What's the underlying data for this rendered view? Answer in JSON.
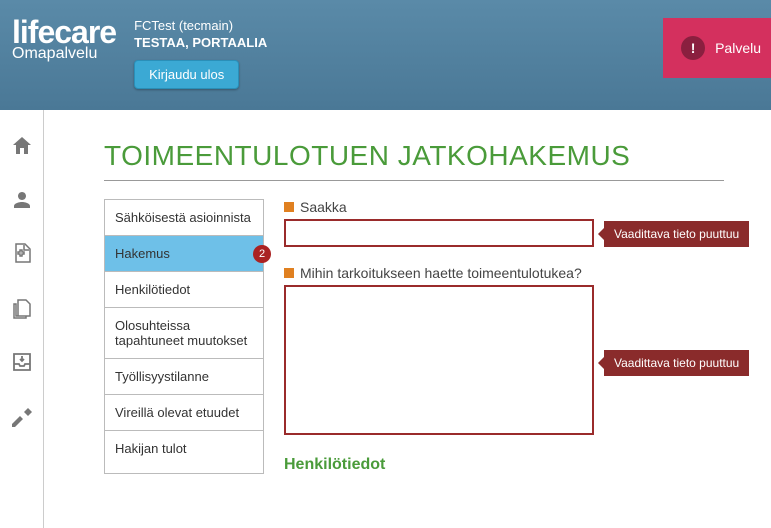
{
  "header": {
    "logo_main": "lifecare",
    "logo_sub": "Omapalvelu",
    "user_context": "FCTest (tecmain)",
    "user_name": "TESTAA, PORTAALIA",
    "logout_label": "Kirjaudu ulos",
    "alert_label": "Palvelu",
    "alert_glyph": "!"
  },
  "page": {
    "title": "TOIMEENTULOTUEN JATKOHAKEMUS"
  },
  "steps": [
    {
      "label": "Sähköisestä asioinnista",
      "active": false
    },
    {
      "label": "Hakemus",
      "active": true,
      "badge": "2"
    },
    {
      "label": "Henkilötiedot",
      "active": false
    },
    {
      "label": "Olosuhteissa tapahtuneet muutokset",
      "active": false
    },
    {
      "label": "Työllisyystilanne",
      "active": false
    },
    {
      "label": "Vireillä olevat etuudet",
      "active": false
    },
    {
      "label": "Hakijan tulot",
      "active": false
    }
  ],
  "form": {
    "field1_label": "Saakka",
    "field1_value": "",
    "field1_error": "Vaadittava tieto puuttuu",
    "field2_label": "Mihin tarkoitukseen haette toimeentulotukea?",
    "field2_value": "",
    "field2_error": "Vaadittava tieto puuttuu",
    "next_section": "Henkilötiedot"
  }
}
